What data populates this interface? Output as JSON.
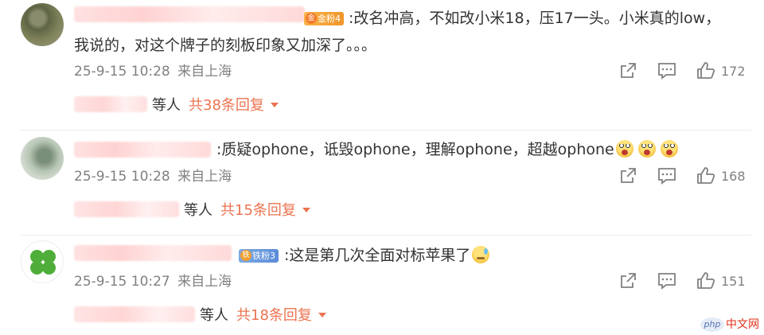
{
  "comments": [
    {
      "badge": "金粉4",
      "text_line1": ":改名冲高，不如改小米18，压17一头。小米真的low，",
      "text_line2": "我说的，对这个牌子的刻板印象又加深了。。。",
      "time": "25-9-15 10:28",
      "location": "来自上海",
      "likes": "172",
      "replies_suffix": "等人",
      "replies_label": "共38条回复"
    },
    {
      "badge": "",
      "text_line1": ":质疑ophone，诋毁ophone，理解ophone，超越ophone",
      "emojis": [
        "shocked-emoji",
        "shocked-emoji",
        "shocked-emoji"
      ],
      "time": "25-9-15 10:28",
      "location": "来自上海",
      "likes": "168",
      "replies_suffix": "等人",
      "replies_label": "共15条回复"
    },
    {
      "badge": "铁粉3",
      "text_line1": ":这是第几次全面对标苹果了",
      "emojis": [
        "sweat-emoji"
      ],
      "time": "25-9-15 10:27",
      "location": "来自上海",
      "likes": "151",
      "replies_suffix": "等人",
      "replies_label": "共18条回复"
    }
  ],
  "icons": [
    "share-icon",
    "comment-icon",
    "like-icon",
    "caret-down-icon"
  ],
  "colors": {
    "accent": "#eb7350",
    "meta": "#808080",
    "text": "#333333"
  },
  "watermark": {
    "logo": "php",
    "site": "中文网"
  }
}
